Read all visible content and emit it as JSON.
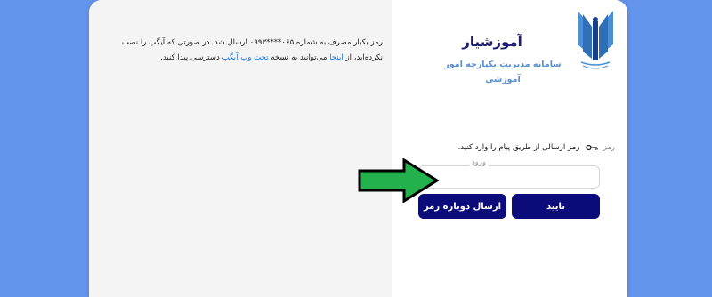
{
  "colors": {
    "page_bg": "#6495ed",
    "primary": "#0b0b7a",
    "title": "#1a1a6e",
    "subtitle": "#5a8ed6",
    "link": "#1a73e8",
    "arrow": "#22b14c"
  },
  "info": {
    "line1": "رمز یکبار مصرف به شماره ۰۶۵****۰۹۹۳ ارسال شد. در صورتی که آیگپ را نصب",
    "line2_before": "نکرده‌اید، از ",
    "line2_link1": "اینجا",
    "line2_mid": " می‌توانید به نسخه ",
    "line2_link2": "تحت وب آیگپ",
    "line2_after": " دسترسی پیدا کنید."
  },
  "brand": {
    "logo_icon": "azad-university-logo",
    "title": "آموزشیار",
    "subtitle": "سامانه مدیریت یکپارچه امور آموزشی"
  },
  "form": {
    "field_name": "رمز",
    "field_icon": "key-icon",
    "field_instruction": "رمز ارسالی از طریق پیام را وارد کنید.",
    "input_legend": "ورود",
    "input_value": "",
    "confirm_label": "تایید",
    "resend_label": "ارسال دوباره رمز"
  },
  "annotation": {
    "icon": "arrow-right-icon"
  }
}
